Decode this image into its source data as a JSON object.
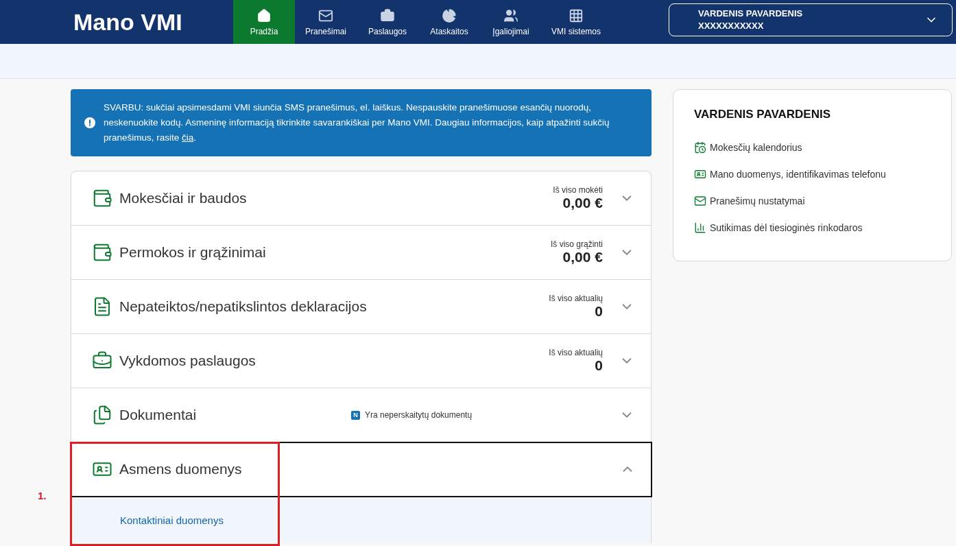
{
  "header": {
    "logo": "Mano VMI",
    "nav": [
      {
        "label": "Pradžia",
        "selected": true
      },
      {
        "label": "Pranešimai",
        "selected": false
      },
      {
        "label": "Paslaugos",
        "selected": false
      },
      {
        "label": "Ataskaitos",
        "selected": false
      },
      {
        "label": "Įgaliojimai",
        "selected": false
      },
      {
        "label": "VMI sistemos",
        "selected": false
      }
    ],
    "user": {
      "name": "VARDENIS PAVARDENIS",
      "code": "XXXXXXXXXXX"
    }
  },
  "notice": {
    "text": "SVARBU: sukčiai apsimesdami VMI siunčia SMS pranešimus, el. laiškus. Nespauskite pranešimuose esančių nuorodų, neskenuokite kodų. Asmeninę informaciją tikrinkite savarankiškai per Mano VMI. Daugiau informacijos, kaip atpažinti sukčių pranešimus, rasite ",
    "link": "čia",
    "text_after": "."
  },
  "sections": [
    {
      "title": "Mokesčiai ir baudos",
      "summary_label": "Iš viso mokėti",
      "summary_value": "0,00 €",
      "expanded": false
    },
    {
      "title": "Permokos ir grąžinimai",
      "summary_label": "Iš viso grąžinti",
      "summary_value": "0,00 €",
      "expanded": false
    },
    {
      "title": "Nepateiktos/nepatikslintos deklaracijos",
      "summary_label": "Iš viso aktualių",
      "summary_value": "0",
      "expanded": false
    },
    {
      "title": "Vykdomos paslaugos",
      "summary_label": "Iš viso aktualių",
      "summary_value": "0",
      "expanded": false
    },
    {
      "title": "Dokumentai",
      "badge": "N",
      "badge_text": "Yra neperskaitytų dokumentų",
      "expanded": false
    },
    {
      "title": "Asmens duomenys",
      "expanded": true,
      "children": [
        "Kontaktiniai duomenys"
      ]
    }
  ],
  "sidebar": {
    "title": "VARDENIS PAVARDENIS",
    "links": [
      "Mokesčių kalendorius",
      "Mano duomenys, identifikavimas telefonu",
      "Pranešimų nustatymai",
      "Sutikimas dėl tiesioginės rinkodaros"
    ]
  },
  "annotation": {
    "label": "1."
  }
}
